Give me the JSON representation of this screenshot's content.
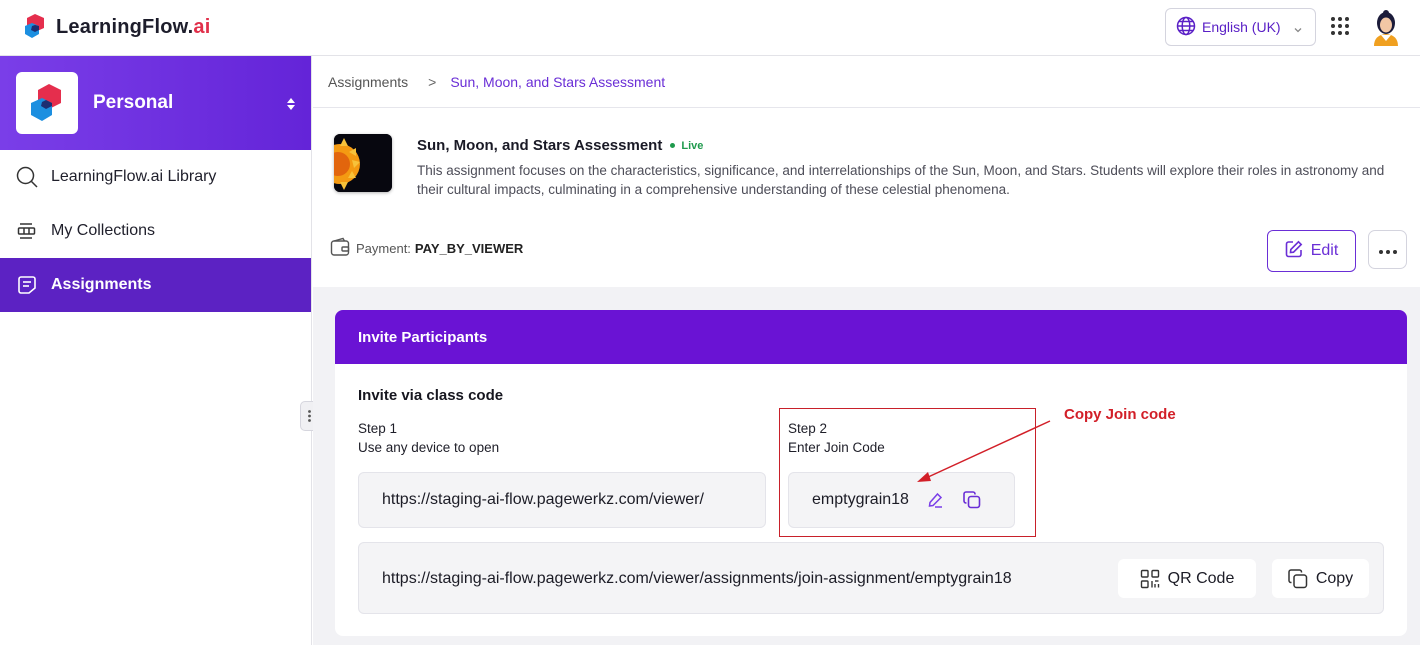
{
  "brand": {
    "name_main": "LearningFlow.",
    "name_suffix": "ai",
    "colors": {
      "accent": "#6a2ed6",
      "header": "#6a13d4",
      "brand_red": "#e1304b"
    }
  },
  "topbar": {
    "language": "English (UK)",
    "icons": [
      "globe-icon",
      "chevron-down-icon",
      "apps-grid-icon",
      "user-avatar"
    ]
  },
  "sidebar": {
    "workspace": {
      "name": "Personal"
    },
    "items": [
      {
        "label": "LearningFlow.ai Library",
        "icon": "search-icon",
        "active": false
      },
      {
        "label": "My Collections",
        "icon": "collections-icon",
        "active": false
      },
      {
        "label": "Assignments",
        "icon": "assignment-icon",
        "active": true
      }
    ]
  },
  "breadcrumb": {
    "parent": "Assignments",
    "separator": ">",
    "current": "Sun, Moon, and Stars Assessment"
  },
  "assignment": {
    "title": "Sun, Moon, and Stars Assessment",
    "status": "Live",
    "description": "This assignment focuses on the characteristics, significance, and interrelationships of the Sun, Moon, and Stars. Students will explore their roles in astronomy and their cultural impacts, culminating in a comprehensive understanding of these celestial phenomena.",
    "payment_label": "Payment:",
    "payment_value": "PAY_BY_VIEWER",
    "edit_label": "Edit"
  },
  "invite": {
    "header": "Invite Participants",
    "subtitle": "Invite via class code",
    "step1_title": "Step 1",
    "step1_text": "Use any device to open",
    "step1_url": "https://staging-ai-flow.pagewerkz.com/viewer/",
    "step2_title": "Step 2",
    "step2_text": "Enter Join Code",
    "join_code": "emptygrain18",
    "full_url": "https://staging-ai-flow.pagewerkz.com/viewer/assignments/join-assignment/emptygrain18",
    "qr_label": "QR Code",
    "copy_label": "Copy"
  },
  "annotation": {
    "label": "Copy Join code",
    "color": "#d21f28"
  }
}
